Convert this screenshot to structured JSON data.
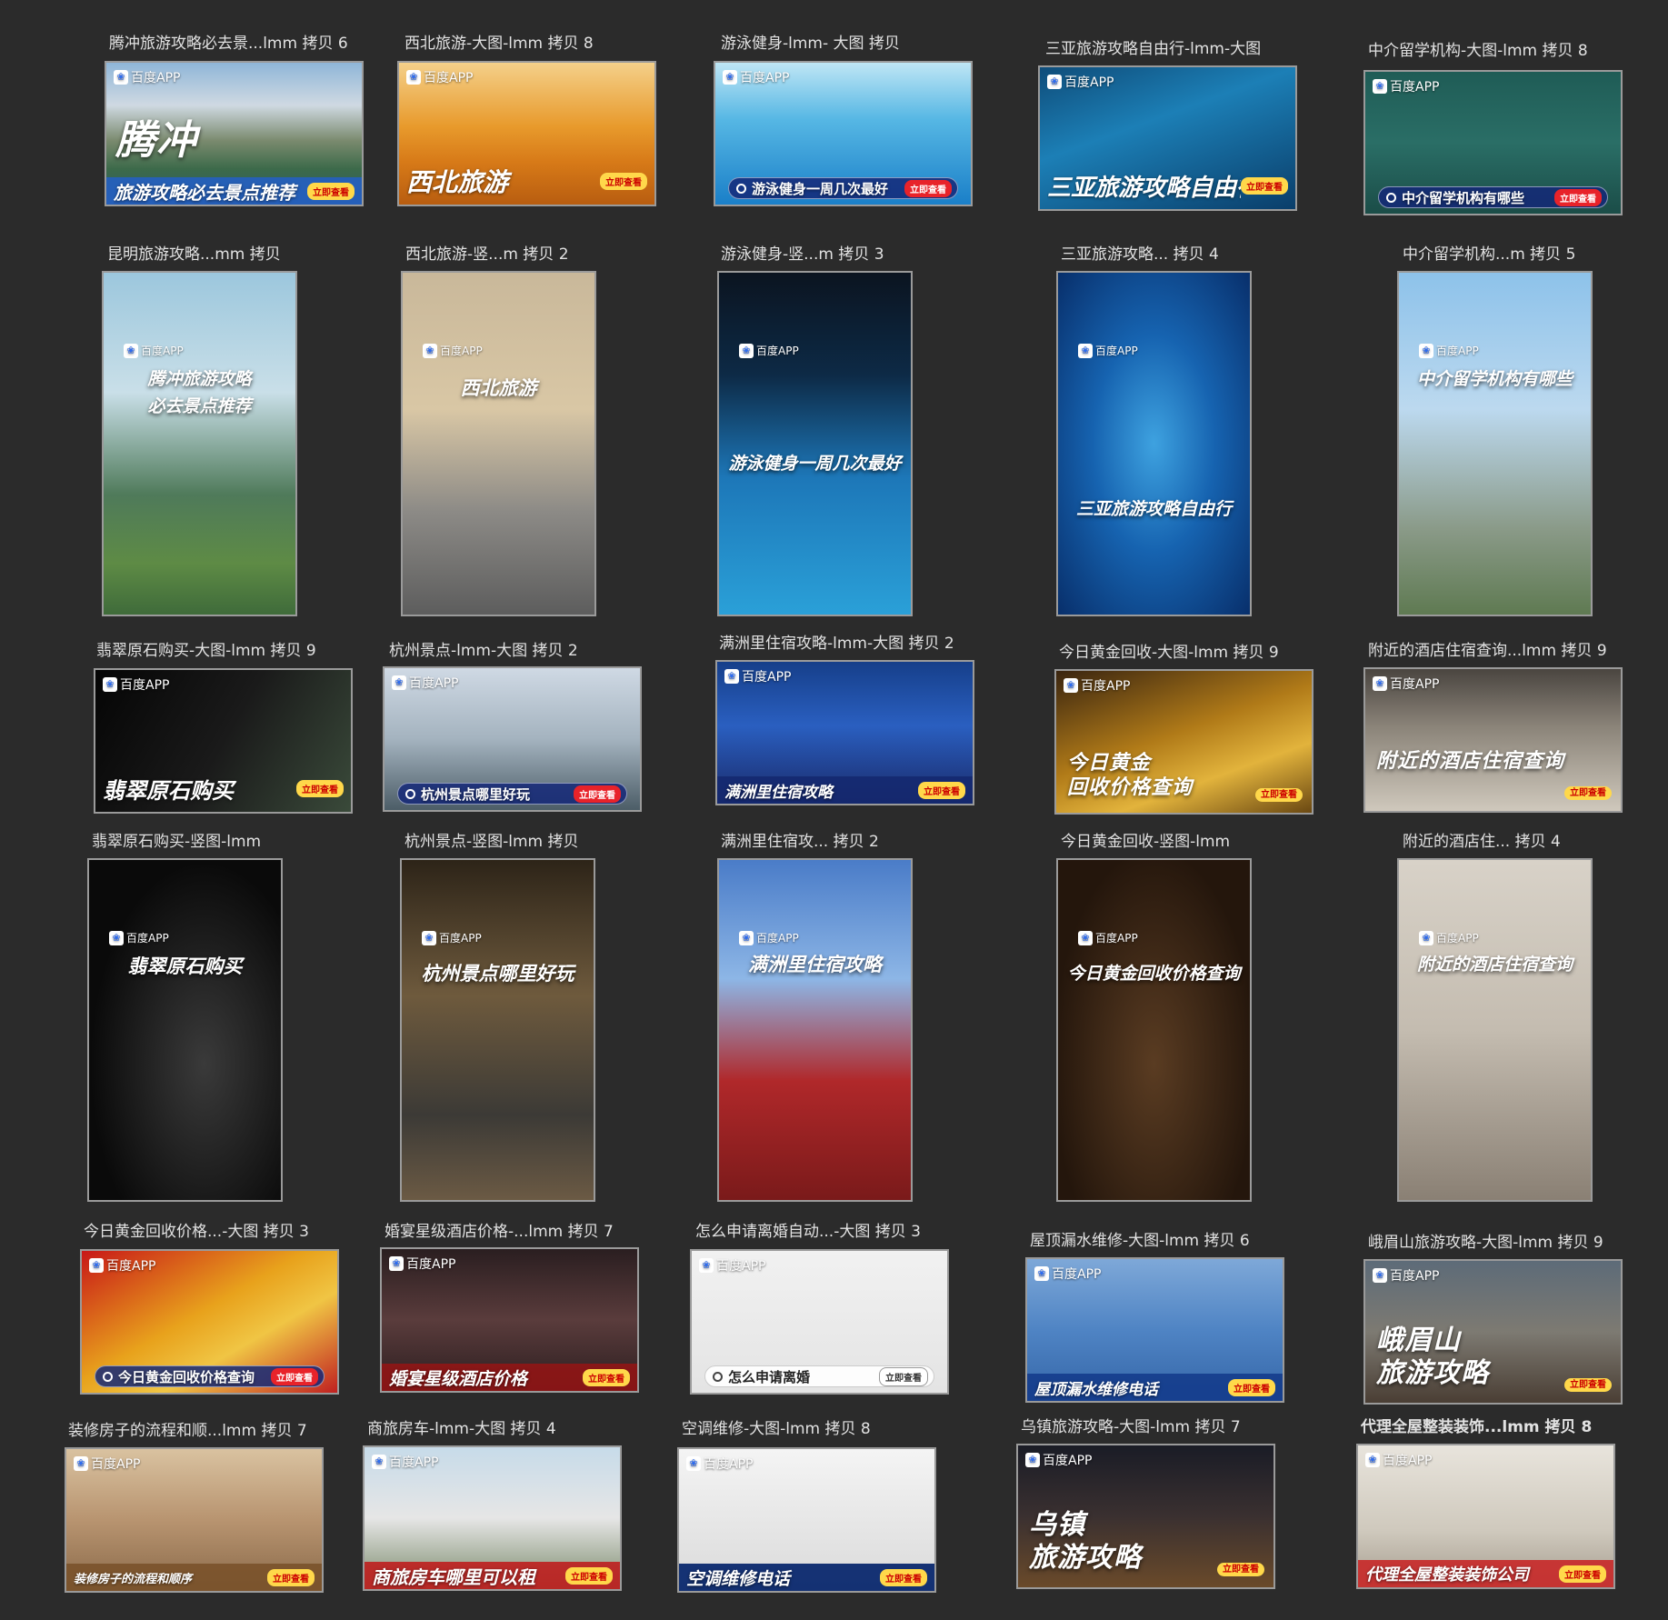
{
  "brand": "百度APP",
  "cta": "立即查看",
  "colors": {
    "background": "#2b2b2b",
    "caption": "#e2e2e2",
    "thumb_border": "#9a9a9a",
    "baidu_blue": "#2e6cf0",
    "cta_yellow": "#ffd84a",
    "cta_red": "#e8232a"
  },
  "icons": {
    "brand": "baidu-paw-icon",
    "search": "search-icon"
  },
  "rows": [
    [
      {
        "caption": "腾冲旅游攻略必去景...lmm 拷贝 6",
        "headline": "腾冲",
        "bar": "旅游攻略必去景点推荐"
      },
      {
        "caption": "西北旅游-大图-lmm 拷贝 8",
        "headline": "",
        "bar": "西北旅游"
      },
      {
        "caption": "游泳健身-lmm- 大图 拷贝",
        "headline": "",
        "bar": "游泳健身一周几次最好"
      },
      {
        "caption": "三亚旅游攻略自由行-lmm-大图",
        "headline": "",
        "bar": "三亚旅游攻略自由行"
      },
      {
        "caption": "中介留学机构-大图-lmm 拷贝 8",
        "headline": "",
        "bar": "中介留学机构有哪些"
      }
    ],
    [
      {
        "caption": "昆明旅游攻略...mm 拷贝",
        "headline": "腾冲旅游攻略\n必去景点推荐"
      },
      {
        "caption": "西北旅游-竖...m 拷贝 2",
        "headline": "西北旅游"
      },
      {
        "caption": "游泳健身-竖...m 拷贝 3",
        "headline": "游泳健身一周几次最好"
      },
      {
        "caption": "三亚旅游攻略... 拷贝 4",
        "headline": "三亚旅游攻略自由行"
      },
      {
        "caption": "中介留学机构...m 拷贝 5",
        "headline": "中介留学机构有哪些"
      }
    ],
    [
      {
        "caption": "翡翠原石购买-大图-lmm 拷贝 9",
        "headline": "",
        "bar": "翡翠原石购买"
      },
      {
        "caption": "杭州景点-lmm-大图 拷贝 2",
        "headline": "",
        "bar": "杭州景点哪里好玩"
      },
      {
        "caption": "满洲里住宿攻略-lmm-大图 拷贝 2",
        "headline": "",
        "bar": "满洲里住宿攻略"
      },
      {
        "caption": "今日黄金回收-大图-lmm 拷贝 9",
        "headline": "今日黄金\n回收价格查询",
        "bar": ""
      },
      {
        "caption": "附近的酒店住宿查询...lmm 拷贝 9",
        "headline": "附近的酒店住宿查询",
        "bar": ""
      }
    ],
    [
      {
        "caption": "翡翠原石购买-竖图-lmm",
        "headline": "翡翠原石购买"
      },
      {
        "caption": "杭州景点-竖图-lmm 拷贝",
        "headline": "杭州景点哪里好玩"
      },
      {
        "caption": "满洲里住宿攻... 拷贝 2",
        "headline": "满洲里住宿攻略"
      },
      {
        "caption": "今日黄金回收-竖图-lmm",
        "headline": "今日黄金回收价格查询"
      },
      {
        "caption": "附近的酒店住... 拷贝 4",
        "headline": "附近的酒店住宿查询"
      }
    ],
    [
      {
        "caption": "今日黄金回收价格...-大图 拷贝 3",
        "headline": "",
        "bar": "今日黄金回收价格查询"
      },
      {
        "caption": "婚宴星级酒店价格-...lmm 拷贝 7",
        "headline": "",
        "bar": "婚宴星级酒店价格"
      },
      {
        "caption": "怎么申请离婚自动...-大图 拷贝 3",
        "headline": "",
        "bar": "怎么申请离婚"
      },
      {
        "caption": "屋顶漏水维修-大图-lmm 拷贝 6",
        "headline": "",
        "bar": "屋顶漏水维修电话"
      },
      {
        "caption": "峨眉山旅游攻略-大图-lmm 拷贝 9",
        "headline": "峨眉山\n旅游攻略",
        "bar": ""
      }
    ],
    [
      {
        "caption": "装修房子的流程和顺...lmm 拷贝 7",
        "headline": "",
        "bar": "装修房子的流程和顺序"
      },
      {
        "caption": "商旅房车-lmm-大图 拷贝 4",
        "headline": "",
        "bar": "商旅房车哪里可以租"
      },
      {
        "caption": "空调维修-大图-lmm 拷贝 8",
        "headline": "",
        "bar": "空调维修电话"
      },
      {
        "caption": "乌镇旅游攻略-大图-lmm 拷贝 7",
        "headline": "乌镇\n旅游攻略",
        "bar": ""
      },
      {
        "caption": "代理全屋整装装饰...lmm 拷贝 8",
        "headline": "",
        "bar": "代理全屋整装装饰公司"
      }
    ]
  ]
}
